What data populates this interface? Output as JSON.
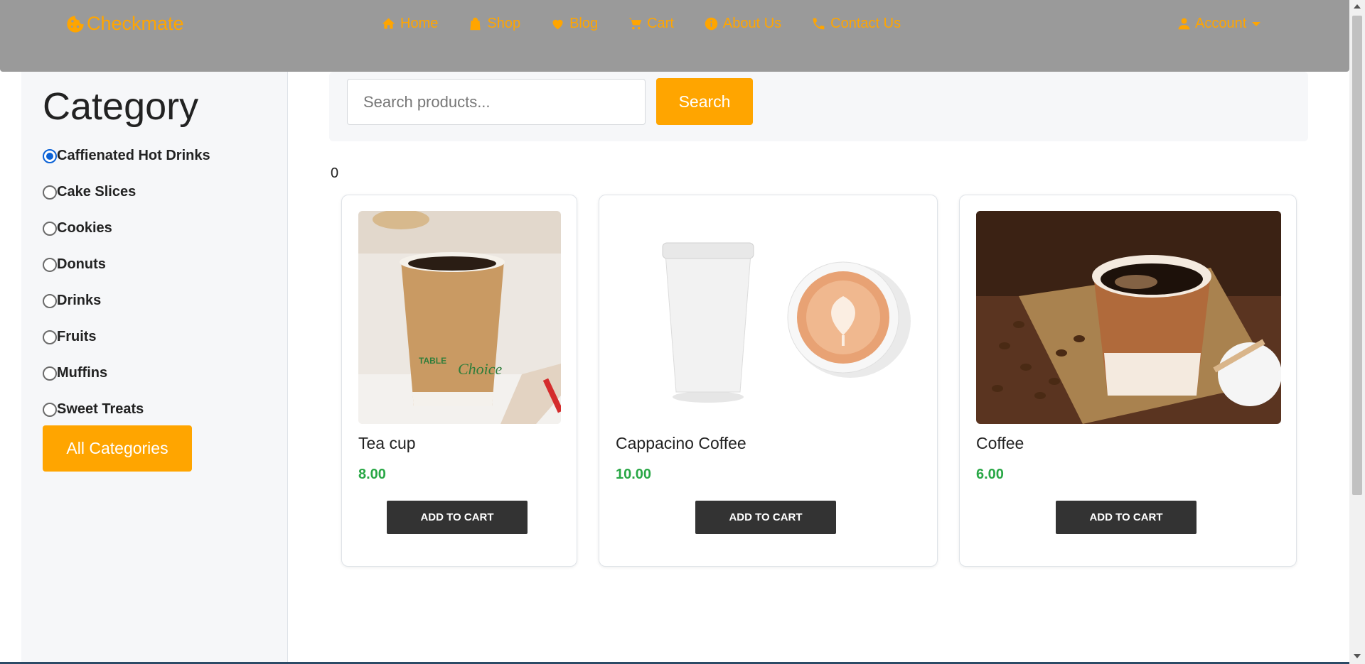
{
  "brand": {
    "name": "Checkmate",
    "icon": "cookie-icon",
    "color": "#ffa500"
  },
  "nav": {
    "items": [
      {
        "label": "Home",
        "icon": "home-icon"
      },
      {
        "label": "Shop",
        "icon": "shopping-bag-icon"
      },
      {
        "label": "Blog",
        "icon": "heart-icon"
      },
      {
        "label": "Cart",
        "icon": "cart-icon"
      },
      {
        "label": "About Us",
        "icon": "info-icon"
      },
      {
        "label": "Contact Us",
        "icon": "phone-icon"
      }
    ],
    "account_label": "Account",
    "account_icon": "user-icon"
  },
  "sidebar": {
    "title": "Category",
    "categories": [
      {
        "label": "Caffienated Hot Drinks",
        "selected": true
      },
      {
        "label": "Cake Slices",
        "selected": false
      },
      {
        "label": "Cookies",
        "selected": false
      },
      {
        "label": "Donuts",
        "selected": false
      },
      {
        "label": "Drinks",
        "selected": false
      },
      {
        "label": "Fruits",
        "selected": false
      },
      {
        "label": "Muffins",
        "selected": false
      },
      {
        "label": "Sweet Treats",
        "selected": false
      }
    ],
    "all_button": "All Categories"
  },
  "search": {
    "placeholder": "Search products...",
    "value": "",
    "button": "Search"
  },
  "result_count": "0",
  "products": [
    {
      "name": "Tea cup",
      "price": "8.00",
      "button": "ADD TO CART",
      "image": "paper-tea-cup-photo"
    },
    {
      "name": "Cappacino Coffee",
      "price": "10.00",
      "button": "ADD TO CART",
      "image": "cappuccino-cups-photo"
    },
    {
      "name": "Coffee",
      "price": "6.00",
      "button": "ADD TO CART",
      "image": "coffee-cup-beans-photo"
    }
  ],
  "colors": {
    "accent": "#ffa500",
    "navbar": "#9a9a9a",
    "price": "#28a745",
    "button_dark": "#333333",
    "radio_selected": "#0b62d6"
  }
}
